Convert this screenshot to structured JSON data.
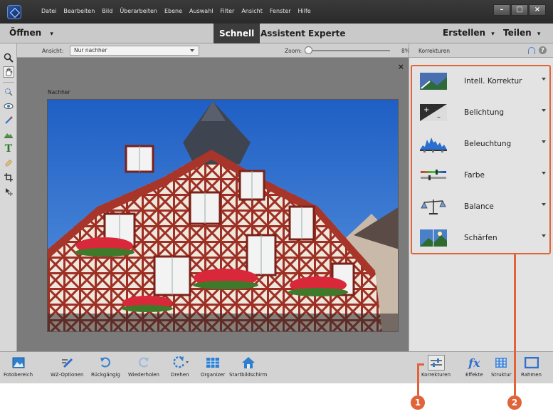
{
  "menu": {
    "items": [
      "Datei",
      "Bearbeiten",
      "Bild",
      "Überarbeiten",
      "Ebene",
      "Auswahl",
      "Filter",
      "Ansicht",
      "Fenster",
      "Hilfe"
    ]
  },
  "window_buttons": {
    "minimize": "–",
    "maximize": "□",
    "close": "×"
  },
  "modebar": {
    "open_label": "Öffnen",
    "tabs": [
      {
        "label": "Schnell",
        "active": true
      },
      {
        "label": "Assistent",
        "active": false
      },
      {
        "label": "Experte",
        "active": false
      }
    ],
    "create_label": "Erstellen",
    "share_label": "Teilen"
  },
  "options": {
    "view_label": "Ansicht:",
    "view_value": "Nur nachher",
    "zoom_label": "Zoom:",
    "zoom_value": "8%",
    "zoom_fraction": 0.02
  },
  "canvas": {
    "close_symbol": "×",
    "view_caption": "Nachher"
  },
  "panel": {
    "title": "Korrekturen",
    "items": [
      {
        "label": "Intell. Korrektur",
        "icon": "smart-fix-icon"
      },
      {
        "label": "Belichtung",
        "icon": "exposure-icon"
      },
      {
        "label": "Beleuchtung",
        "icon": "lighting-icon"
      },
      {
        "label": "Farbe",
        "icon": "color-icon"
      },
      {
        "label": "Balance",
        "icon": "balance-icon"
      },
      {
        "label": "Schärfen",
        "icon": "sharpen-icon"
      }
    ]
  },
  "bottombar": {
    "left": [
      {
        "label": "Fotobereich",
        "icon": "photo-bin-icon"
      },
      {
        "label": "WZ-Optionen",
        "icon": "tool-options-icon"
      },
      {
        "label": "Rückgängig",
        "icon": "undo-icon"
      },
      {
        "label": "Wiederholen",
        "icon": "redo-icon"
      },
      {
        "label": "Drehen",
        "icon": "rotate-icon"
      },
      {
        "label": "Organizer",
        "icon": "organizer-icon"
      },
      {
        "label": "Startbildschirm",
        "icon": "home-icon"
      }
    ],
    "right": [
      {
        "label": "Korrekturen",
        "icon": "adjustments-icon"
      },
      {
        "label": "Effekte",
        "icon": "effects-icon"
      },
      {
        "label": "Struktur",
        "icon": "textures-icon"
      },
      {
        "label": "Rahmen",
        "icon": "frames-icon"
      }
    ]
  },
  "callouts": [
    "1",
    "2"
  ],
  "colors": {
    "accent": "#e0633a",
    "sky": "#2a68c8",
    "timber": "#9e2f24"
  }
}
